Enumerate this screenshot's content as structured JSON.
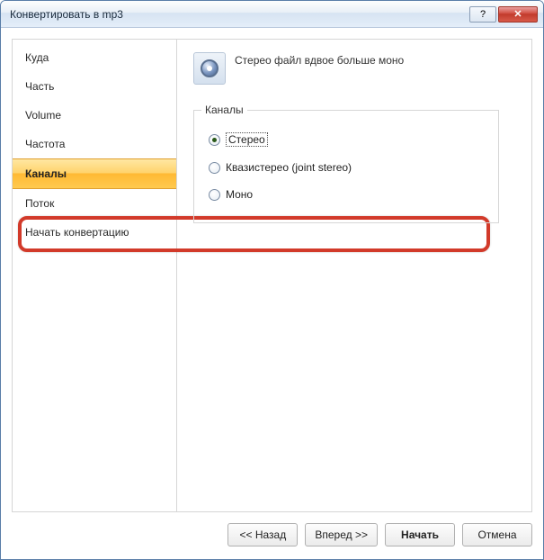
{
  "window": {
    "title": "Конвертировать в mp3"
  },
  "sidebar": {
    "items": [
      {
        "label": "Куда"
      },
      {
        "label": "Часть"
      },
      {
        "label": "Volume"
      },
      {
        "label": "Частота"
      },
      {
        "label": "Каналы",
        "selected": true
      },
      {
        "label": "Поток"
      },
      {
        "label": "Начать конвертацию"
      }
    ]
  },
  "content": {
    "heading": "Стерео файл вдвое больше моно",
    "group_label": "Каналы",
    "options": [
      {
        "label": "Стерео",
        "checked": true
      },
      {
        "label": "Квазистерео (joint stereo)",
        "checked": false
      },
      {
        "label": "Моно",
        "checked": false
      }
    ]
  },
  "footer": {
    "back": "<< Назад",
    "next": "Вперед >>",
    "start": "Начать",
    "cancel": "Отмена"
  }
}
